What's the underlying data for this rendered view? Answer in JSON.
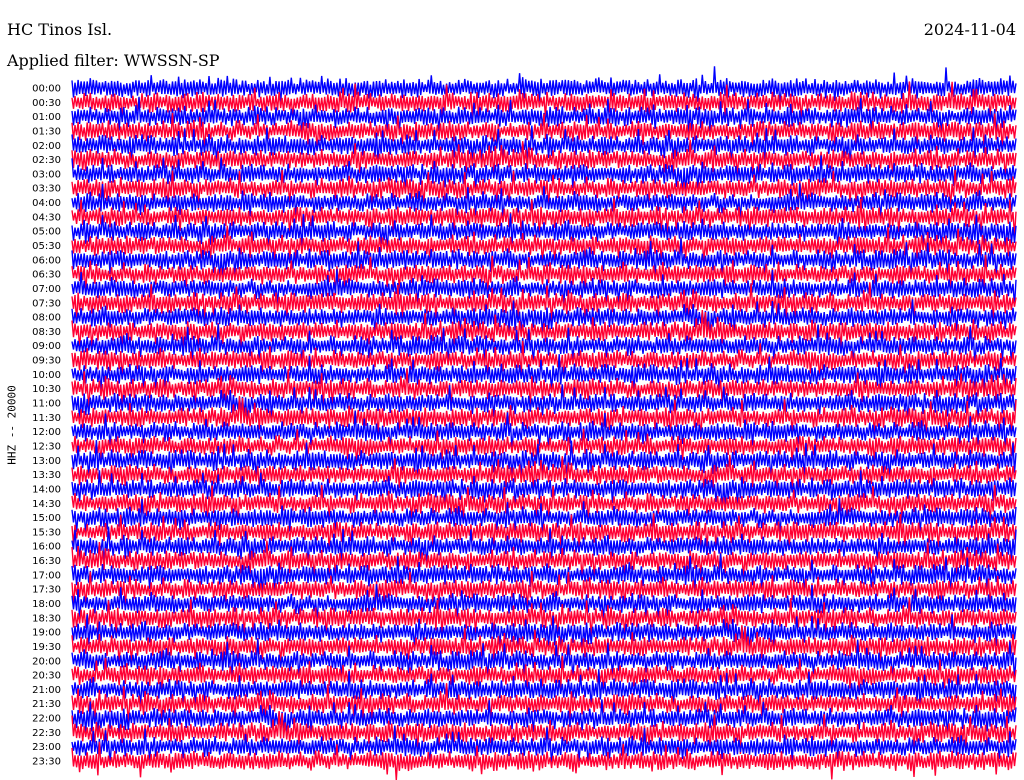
{
  "header": {
    "station": "HC Tinos Isl.",
    "date": "2024-11-04",
    "filter": "Applied filter: WWSSN-SP"
  },
  "chart_data": {
    "type": "line",
    "subtype": "helicorder",
    "title": "HC Tinos Isl.",
    "date": "2024-11-04",
    "filter": "WWSSN-SP",
    "ylabel": "HHZ -- 20000",
    "xlabel": "",
    "row_times": [
      "00:00",
      "00:30",
      "01:00",
      "01:30",
      "02:00",
      "02:30",
      "03:00",
      "03:30",
      "04:00",
      "04:30",
      "05:00",
      "05:30",
      "06:00",
      "06:30",
      "07:00",
      "07:30",
      "08:00",
      "08:30",
      "09:00",
      "09:30",
      "10:00",
      "10:30",
      "11:00",
      "11:30",
      "12:00",
      "12:30",
      "13:00",
      "13:30",
      "14:00",
      "14:30",
      "15:00",
      "15:30",
      "16:00",
      "16:30",
      "17:00",
      "17:30",
      "18:00",
      "18:30",
      "19:00",
      "19:30",
      "20:00",
      "20:30",
      "21:00",
      "21:30",
      "22:00",
      "22:30",
      "23:00",
      "23:30"
    ],
    "trace_colors": [
      "#0000ff",
      "#ff0033"
    ],
    "rows_per_hour": 2,
    "grid": false,
    "legend": "none"
  }
}
